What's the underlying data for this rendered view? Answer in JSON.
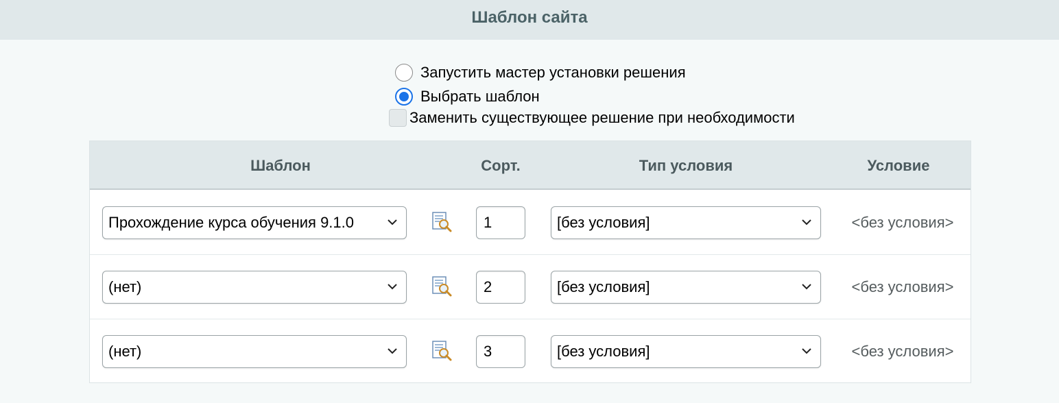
{
  "header": {
    "title": "Шаблон сайта"
  },
  "options": {
    "run_wizard": {
      "label": "Запустить мастер установки решения",
      "checked": false
    },
    "choose_template": {
      "label": "Выбрать шаблон",
      "checked": true
    },
    "replace_solution": {
      "label": "Заменить существующее решение при необходимости",
      "checked": false
    }
  },
  "table": {
    "columns": {
      "template": "Шаблон",
      "sort": "Сорт.",
      "condition_type": "Тип условия",
      "condition": "Условие"
    },
    "rows": [
      {
        "template": "Прохождение курса обучения 9.1.0",
        "sort": "1",
        "condition_type": "[без условия]",
        "condition": "<без условия>"
      },
      {
        "template": "(нет)",
        "sort": "2",
        "condition_type": "[без условия]",
        "condition": "<без условия>"
      },
      {
        "template": "(нет)",
        "sort": "3",
        "condition_type": "[без условия]",
        "condition": "<без условия>"
      }
    ]
  },
  "icons": {
    "preview": "preview-template-icon",
    "dropdown": "chevron-down-icon"
  },
  "colors": {
    "accent": "#1a73e8",
    "header_bg": "#e0e8ea",
    "page_bg": "#f5f9f9"
  }
}
